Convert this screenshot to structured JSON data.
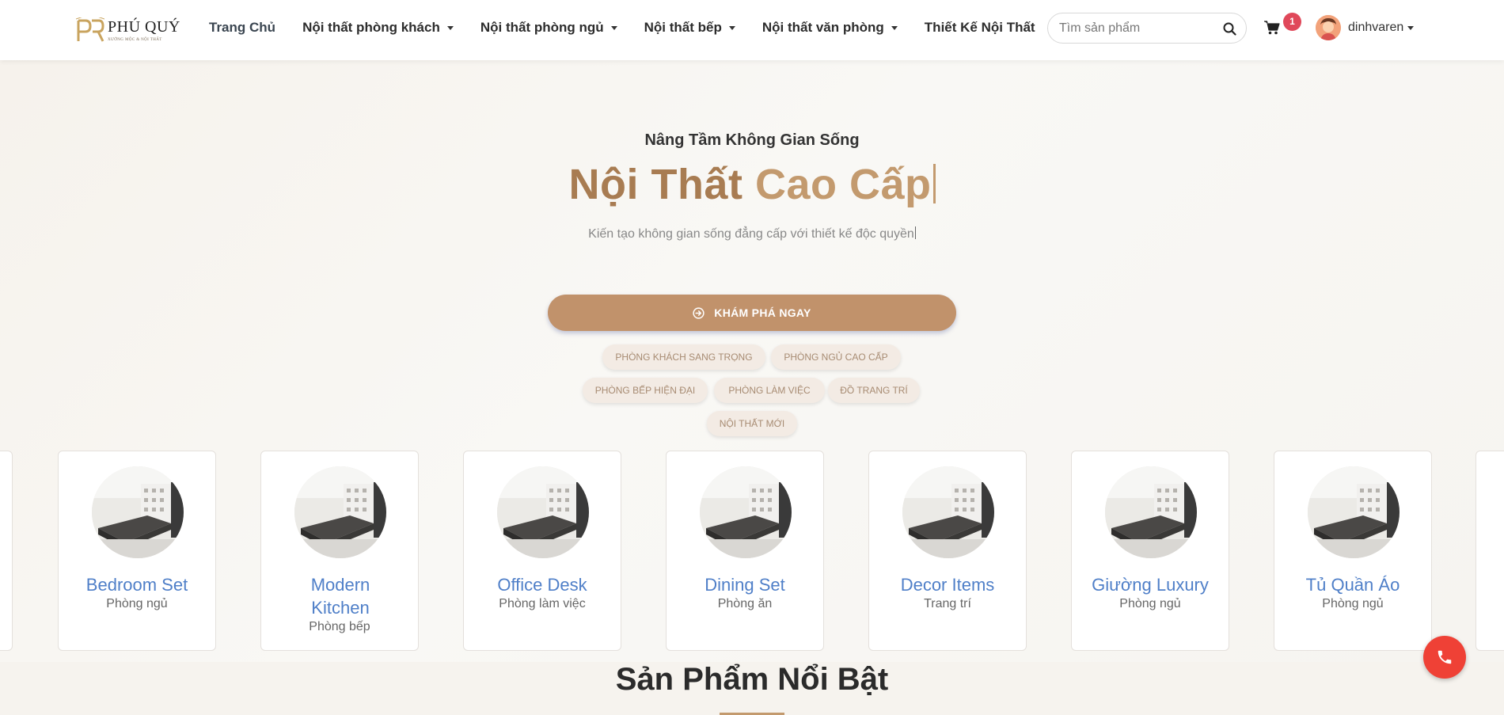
{
  "brand": {
    "monogram": "PQ",
    "name": "PHÚ QUÝ",
    "tagline": "XƯỞNG MỘC & NỘI THẤT"
  },
  "nav": {
    "items": [
      {
        "label": "Trang Chủ",
        "dropdown": false
      },
      {
        "label": "Nội thất phòng khách",
        "dropdown": true
      },
      {
        "label": "Nội thất phòng ngủ",
        "dropdown": true
      },
      {
        "label": "Nội thất bếp",
        "dropdown": true
      },
      {
        "label": "Nội thất văn phòng",
        "dropdown": true
      },
      {
        "label": "Thiết Kế Nội Thất",
        "dropdown": false
      }
    ]
  },
  "search": {
    "placeholder": "Tìm sản phẩm",
    "value": ""
  },
  "cart": {
    "count": "1"
  },
  "user": {
    "name": "dinhvaren"
  },
  "hero": {
    "pre_title": "Nâng Tầm Không Gian Sống",
    "title_part1": "Nội Thất",
    "title_part2": "Cao Cấp",
    "subtitle": "Kiến tạo không gian sống đẳng cấp với thiết kế độc quyền",
    "cta_label": "KHÁM PHÁ NGAY",
    "tags": [
      "PHÒNG KHÁCH SANG TRỌNG",
      "PHÒNG NGỦ CAO CẤP",
      "PHÒNG BẾP HIỆN ĐẠI",
      "PHÒNG LÀM VIỆC",
      "ĐỒ TRANG TRÍ",
      "NỘI THẤT MỚI"
    ]
  },
  "carousel": {
    "cards": [
      {
        "title": "Bedroom Set",
        "subtitle": "Phòng ngủ"
      },
      {
        "title": "Modern Kitchen",
        "subtitle": "Phòng bếp"
      },
      {
        "title": "Office Desk",
        "subtitle": "Phòng làm việc"
      },
      {
        "title": "Dining Set",
        "subtitle": "Phòng ăn"
      },
      {
        "title": "Decor Items",
        "subtitle": "Trang trí"
      },
      {
        "title": "Giường Luxury",
        "subtitle": "Phòng ngủ"
      },
      {
        "title": "Tủ Quần Áo",
        "subtitle": "Phòng ngủ"
      }
    ]
  },
  "featured": {
    "title": "Sản Phẩm Nổi Bật"
  },
  "colors": {
    "accent": "#c1926b",
    "title_brown": "#a87c52",
    "card_title": "#4f7fc8",
    "phone_red": "#ef4136",
    "badge": "#e0485a"
  }
}
